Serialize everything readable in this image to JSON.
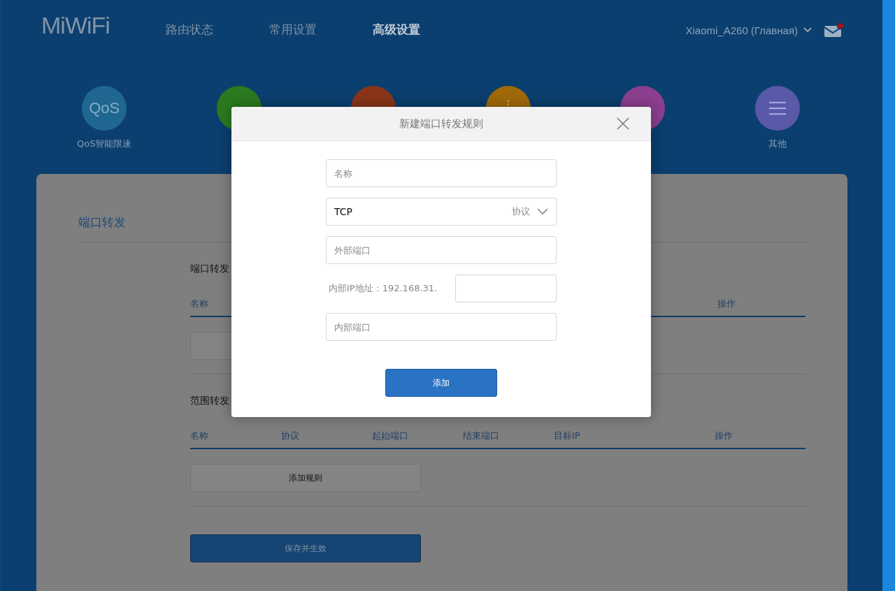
{
  "header": {
    "logo": "MiWiFi",
    "nav": [
      {
        "label": "路由状态",
        "selected": false
      },
      {
        "label": "常用设置",
        "selected": false
      },
      {
        "label": "高级设置",
        "selected": true
      }
    ],
    "router": "Xiaomi_A260 (Главная)",
    "mail": {
      "unread": true
    }
  },
  "shortcuts": [
    {
      "kind": "text",
      "icon_text": "QoS",
      "label": "QoS智能限速",
      "color": "#1f6690"
    },
    {
      "kind": "plain",
      "color": "#2b7a1f"
    },
    {
      "kind": "plain",
      "color": "#8a3519"
    },
    {
      "kind": "cross",
      "color": "#a06a0a"
    },
    {
      "kind": "plain",
      "color": "#8c3f8e"
    },
    {
      "kind": "menu",
      "label": "其他",
      "color": "#5a58a8"
    }
  ],
  "section": {
    "title": "端口转发",
    "tables": [
      {
        "title": "端口转发",
        "columns": [
          "名称",
          "操作"
        ]
      },
      {
        "title": "范围转发",
        "columns": [
          "名称",
          "协议",
          "起始端口",
          "结束端口",
          "目标IP",
          "操作"
        ],
        "button": "添加规则"
      }
    ],
    "save": "保存并生效"
  },
  "dialog": {
    "title": "新建端口转发规则",
    "fields": [
      {
        "kind": "text",
        "placeholder": "名称"
      },
      {
        "kind": "select",
        "value": "TCP",
        "label": "协议"
      },
      {
        "kind": "text",
        "placeholder": "外部端口"
      },
      {
        "kind": "ip",
        "prefix": "内部IP地址：192.168.31."
      },
      {
        "kind": "text",
        "placeholder": "内部端口"
      }
    ],
    "button": "添加"
  }
}
